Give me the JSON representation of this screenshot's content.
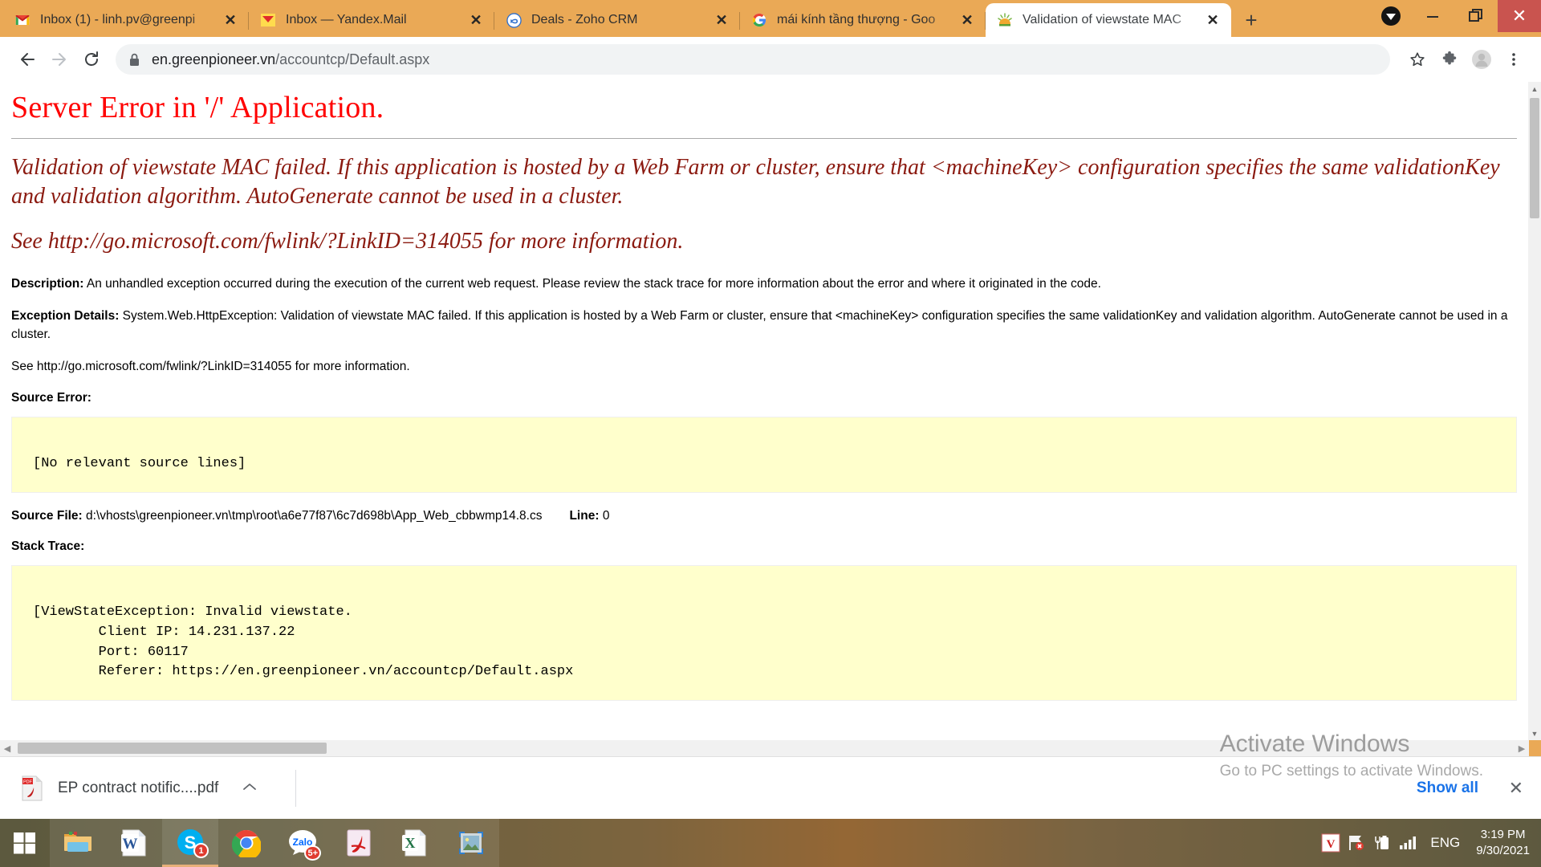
{
  "browser": {
    "tabs": [
      {
        "favicon": "gmail-icon",
        "title": "Inbox (1) - linh.pv@greenpi",
        "active": false
      },
      {
        "favicon": "yandex-mail-icon",
        "title": "Inbox — Yandex.Mail",
        "active": false
      },
      {
        "favicon": "zoho-icon",
        "title": "Deals - Zoho CRM",
        "active": false
      },
      {
        "favicon": "google-icon",
        "title": "mái kính tầng thượng - Goo",
        "active": false
      },
      {
        "favicon": "greenpioneer-icon",
        "title": "Validation of viewstate MAC",
        "active": true
      }
    ],
    "new_tab_label": "+",
    "close_label": "✕",
    "window_controls": {
      "minimize": "—",
      "maximize": "❐",
      "close": "✕"
    },
    "toolbar": {
      "back": "←",
      "forward": "→",
      "reload": "⟳",
      "url_host": "en.greenpioneer.vn",
      "url_path": "/accountcp/Default.aspx",
      "url_full": "en.greenpioneer.vn/accountcp/Default.aspx",
      "star": "☆",
      "extensions": "puzzle-icon",
      "profile": "profile-icon",
      "menu": "⋮"
    }
  },
  "page": {
    "title": "Server Error in '/' Application.",
    "summary": "Validation of viewstate MAC failed. If this application is hosted by a Web Farm or cluster, ensure that <machineKey> configuration specifies the same validationKey and validation algorithm. AutoGenerate cannot be used in a cluster.",
    "link_line": "See http://go.microsoft.com/fwlink/?LinkID=314055 for more information.",
    "description_label": "Description:",
    "description_text": " An unhandled exception occurred during the execution of the current web request. Please review the stack trace for more information about the error and where it originated in the code.",
    "exception_label": "Exception Details:",
    "exception_text": " System.Web.HttpException: Validation of viewstate MAC failed. If this application is hosted by a Web Farm or cluster, ensure that <machineKey> configuration specifies the same validationKey and validation algorithm. AutoGenerate cannot be used in a cluster.",
    "see_more": "See http://go.microsoft.com/fwlink/?LinkID=314055 for more information.",
    "source_error_label": "Source Error:",
    "source_error_code": "\n[No relevant source lines]",
    "source_file_label": "Source File:",
    "source_file_value": "d:\\vhosts\\greenpioneer.vn\\tmp\\root\\a6e77f87\\6c7d698b\\App_Web_cbbwmp14.8.cs",
    "line_label": "Line:",
    "line_value": "0",
    "stack_trace_label": "Stack Trace:",
    "stack_trace_code": "\n[ViewStateException: Invalid viewstate.\n        Client IP: 14.231.137.22\n        Port: 60117\n        Referer: https://en.greenpioneer.vn/accountcp/Default.aspx"
  },
  "watermark": {
    "title": "Activate Windows",
    "subtitle": "Go to PC settings to activate Windows."
  },
  "download_shelf": {
    "file_name": "EP contract notific....pdf",
    "file_icon": "pdf-icon",
    "menu_caret": "⌃",
    "show_all": "Show all",
    "close": "✕"
  },
  "taskbar": {
    "start": "windows-logo-icon",
    "items": [
      {
        "name": "file-explorer-icon",
        "badge": null,
        "state": "running"
      },
      {
        "name": "word-icon",
        "badge": null,
        "state": "running"
      },
      {
        "name": "skype-icon",
        "badge": "1",
        "state": "active"
      },
      {
        "name": "chrome-icon",
        "badge": null,
        "state": "running"
      },
      {
        "name": "zalo-icon",
        "badge": "5+",
        "state": "running"
      },
      {
        "name": "acrobat-icon",
        "badge": null,
        "state": "running"
      },
      {
        "name": "excel-icon",
        "badge": null,
        "state": "running"
      },
      {
        "name": "photos-icon",
        "badge": null,
        "state": "running"
      }
    ],
    "tray": {
      "unikey": "V",
      "action_center": "flag-icon",
      "battery": "battery-icon",
      "network": "signal-icon",
      "language": "ENG",
      "time": "3:19 PM",
      "date": "9/30/2021"
    }
  },
  "colors": {
    "browser_frame": "#eaa956",
    "error_red": "#ff0000",
    "error_dark_red": "#8b1a10",
    "code_bg": "#ffffcc",
    "link_blue": "#1a73e8"
  }
}
